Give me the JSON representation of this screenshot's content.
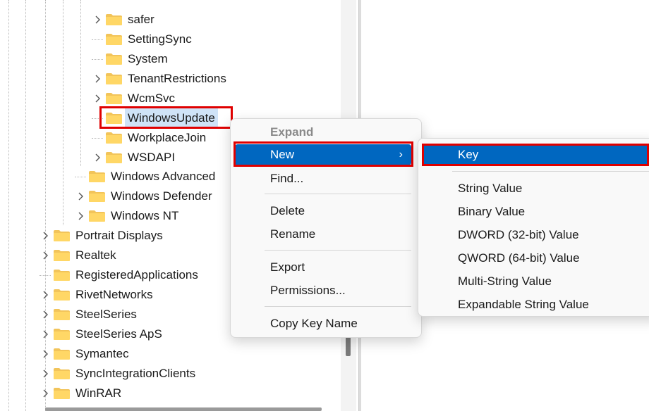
{
  "tree": {
    "nodes": [
      {
        "label": "safer",
        "expandable": true,
        "level": 3
      },
      {
        "label": "SettingSync",
        "expandable": false,
        "level": 3
      },
      {
        "label": "System",
        "expandable": false,
        "level": 3
      },
      {
        "label": "TenantRestrictions",
        "expandable": true,
        "level": 3
      },
      {
        "label": "WcmSvc",
        "expandable": true,
        "level": 3
      },
      {
        "label": "WindowsUpdate",
        "expandable": false,
        "level": 3,
        "selected": true
      },
      {
        "label": "WorkplaceJoin",
        "expandable": false,
        "level": 3
      },
      {
        "label": "WSDAPI",
        "expandable": true,
        "level": 3
      },
      {
        "label": "Windows Advanced",
        "expandable": false,
        "level": 2
      },
      {
        "label": "Windows Defender",
        "expandable": true,
        "level": 2
      },
      {
        "label": "Windows NT",
        "expandable": true,
        "level": 2
      },
      {
        "label": "Portrait Displays",
        "expandable": true,
        "level": 1
      },
      {
        "label": "Realtek",
        "expandable": true,
        "level": 1
      },
      {
        "label": "RegisteredApplications",
        "expandable": false,
        "level": 1
      },
      {
        "label": "RivetNetworks",
        "expandable": true,
        "level": 1
      },
      {
        "label": "SteelSeries",
        "expandable": true,
        "level": 1
      },
      {
        "label": "SteelSeries ApS",
        "expandable": true,
        "level": 1
      },
      {
        "label": "Symantec",
        "expandable": true,
        "level": 1
      },
      {
        "label": "SyncIntegrationClients",
        "expandable": true,
        "level": 1
      },
      {
        "label": "WinRAR",
        "expandable": true,
        "level": 1
      }
    ]
  },
  "context_menu": {
    "items": [
      {
        "label": "Expand",
        "state": "disabled"
      },
      {
        "label": "New",
        "state": "active",
        "submenu": true
      },
      {
        "label": "Find...",
        "state": "normal"
      },
      {
        "label": "Delete",
        "state": "normal"
      },
      {
        "label": "Rename",
        "state": "normal"
      },
      {
        "label": "Export",
        "state": "normal"
      },
      {
        "label": "Permissions...",
        "state": "normal"
      },
      {
        "label": "Copy Key Name",
        "state": "normal"
      }
    ]
  },
  "new_submenu": {
    "items": [
      {
        "label": "Key",
        "state": "active"
      },
      {
        "label": "String Value",
        "state": "normal"
      },
      {
        "label": "Binary Value",
        "state": "normal"
      },
      {
        "label": "DWORD (32-bit) Value",
        "state": "normal"
      },
      {
        "label": "QWORD (64-bit) Value",
        "state": "normal"
      },
      {
        "label": "Multi-String Value",
        "state": "normal"
      },
      {
        "label": "Expandable String Value",
        "state": "normal"
      }
    ]
  },
  "colors": {
    "accent": "#0067c0",
    "highlight": "#e00000",
    "selection": "#cfe3f7",
    "folder": "#f2c45a"
  },
  "icons": {
    "folder": "folder-icon",
    "chevron": "chevron-right-icon"
  }
}
